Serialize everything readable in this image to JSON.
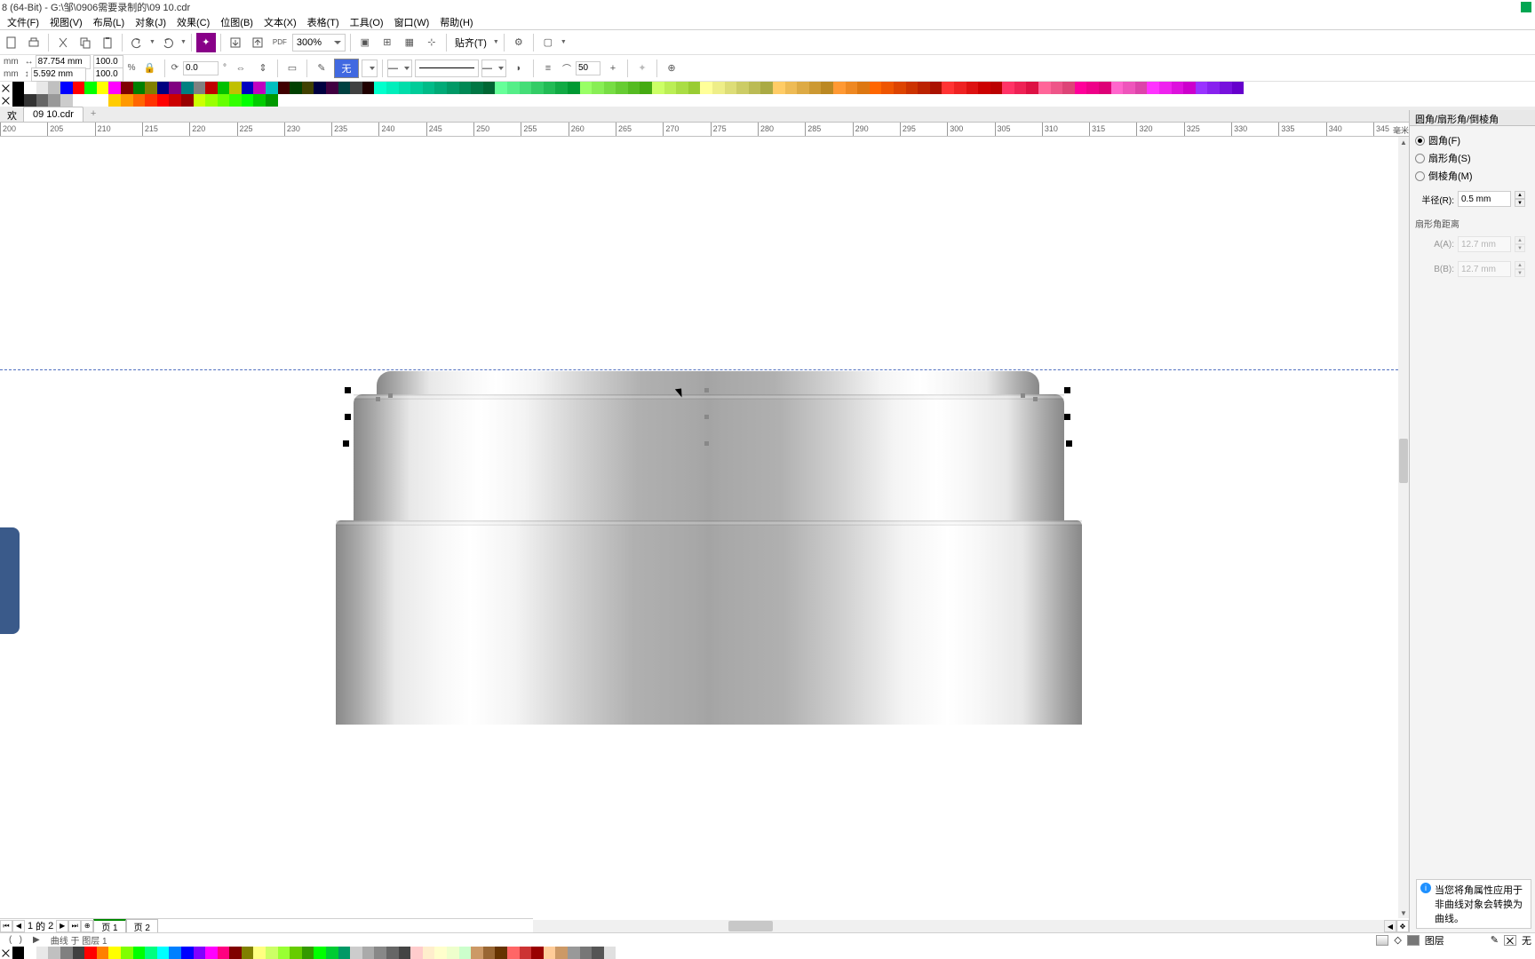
{
  "title": "8 (64-Bit) - G:\\邹\\0906需要录制的\\09 10.cdr",
  "menu": [
    "文件(F)",
    "视图(V)",
    "布局(L)",
    "对象(J)",
    "效果(C)",
    "位图(B)",
    "文本(X)",
    "表格(T)",
    "工具(O)",
    "窗口(W)",
    "帮助(H)"
  ],
  "toolbar1": {
    "zoom": "300%",
    "snap": "贴齐(T)"
  },
  "propbar": {
    "unit1": "mm",
    "unit2": "mm",
    "w": "87.754 mm",
    "h": "5.592 mm",
    "sx": "100.0",
    "sy": "100.0",
    "pct": "%",
    "rot": "0.0",
    "rot_unit": "°",
    "outline_val": "50",
    "none_label": "无"
  },
  "doc_tabs": {
    "first": "欢迎屏幕",
    "active": "09 10.cdr",
    "plus": "+"
  },
  "ruler": {
    "start": 200,
    "end": 345,
    "step": 5,
    "unit": "毫米"
  },
  "panel": {
    "title": "圆角/扇形角/倒棱角",
    "opt1": "圆角(F)",
    "opt2": "扇形角(S)",
    "opt3": "倒棱角(M)",
    "radius_label": "半径(R):",
    "radius_val": "0.5 mm",
    "dist_label": "扇形角距离",
    "a_label": "A(A):",
    "a_val": "12.7 mm",
    "b_label": "B(B):",
    "b_val": "12.7 mm"
  },
  "page_nav": {
    "left2": "⏮",
    "left1": "◀",
    "cur": "1",
    "of": "的",
    "total": "2",
    "right1": "▶",
    "right2": "⏭",
    "add": "⊕",
    "p1": "页 1",
    "p2": "页 2"
  },
  "status": {
    "left1": "▶",
    "object": "曲线 于 图层 1",
    "fill_label": "无",
    "layer": "图层"
  },
  "hint": "当您将角属性应用于非曲线对象会转换为曲线。",
  "colors_top1": [
    "x",
    "#000",
    "#fff",
    "#e8e8e8",
    "#c0c0c0",
    "#0000ff",
    "#ff0000",
    "#00ff00",
    "#ffff00",
    "#ff00ff",
    "#800000",
    "#008000",
    "#808000",
    "#000080",
    "#800080",
    "#008080",
    "#808080",
    "#c00000",
    "#00c000",
    "#c0c000",
    "#0000c0",
    "#c000c0",
    "#00c0c0",
    "#400000",
    "#004000",
    "#404000",
    "#000040",
    "#400040",
    "#004040",
    "#404040",
    "#200000",
    "#00ffcc",
    "#00eebb",
    "#00ddaa",
    "#00cc99",
    "#00bb88",
    "#00aa77",
    "#009966",
    "#008855",
    "#007744",
    "#006633",
    "#66ff99",
    "#55ee88",
    "#44dd77",
    "#33cc66",
    "#22bb55",
    "#11aa44",
    "#009933",
    "#99ff66",
    "#88ee55",
    "#77dd44",
    "#66cc33",
    "#55bb22",
    "#44aa11",
    "#ccff66",
    "#bbee55",
    "#aadd44",
    "#99cc33",
    "#ffff99",
    "#eeee88",
    "#dddd77",
    "#cccc66",
    "#bbbb55",
    "#aaaa44",
    "#ffcc66",
    "#eebb55",
    "#ddaa44",
    "#cc9933",
    "#bb8822",
    "#ff9933",
    "#ee8822",
    "#dd7711",
    "#ff6600",
    "#ee5500",
    "#dd4400",
    "#cc3300",
    "#bb2200",
    "#aa1100",
    "#ff3333",
    "#ee2222",
    "#dd1111",
    "#cc0000",
    "#bb0000",
    "#ff3366",
    "#ee2255",
    "#dd1144",
    "#ff6699",
    "#ee5588",
    "#dd4477",
    "#ff0099",
    "#ee0088",
    "#dd0077",
    "#ff66cc",
    "#ee55bb",
    "#dd44aa",
    "#ff33ff",
    "#ee22ee",
    "#dd11dd",
    "#cc00cc",
    "#9933ff",
    "#8822ee",
    "#7711dd",
    "#6600cc"
  ],
  "colors_top2": [
    "x",
    "#000",
    "#333",
    "#666",
    "#999",
    "#ccc",
    "#fff",
    "#fff",
    "#fff",
    "#ffcc00",
    "#ff9900",
    "#ff6600",
    "#ff3300",
    "#ff0000",
    "#cc0000",
    "#990000",
    "#ccff00",
    "#99ff00",
    "#66ff00",
    "#33ff00",
    "#00ff00",
    "#00cc00",
    "#009900"
  ],
  "colors_bot": [
    "x",
    "#000",
    "#fff",
    "#e8e8e8",
    "#c0c0c0",
    "#808080",
    "#404040",
    "#ff0000",
    "#ff8000",
    "#ffff00",
    "#80ff00",
    "#00ff00",
    "#00ff80",
    "#00ffff",
    "#0080ff",
    "#0000ff",
    "#8000ff",
    "#ff00ff",
    "#ff0080",
    "#800000",
    "#808000",
    "#ffff80",
    "#ccff66",
    "#99ff33",
    "#66cc00",
    "#339900",
    "#00ff00",
    "#00cc33",
    "#009966",
    "#cccccc",
    "#aaaaaa",
    "#888888",
    "#666666",
    "#444444",
    "#ffcccc",
    "#ffeecc",
    "#ffffcc",
    "#eeffcc",
    "#ccffcc",
    "#cc9966",
    "#996633",
    "#663300",
    "#ff6666",
    "#cc3333",
    "#990000",
    "#ffcc99",
    "#cc9966",
    "#999999",
    "#777777",
    "#555555",
    "#e0e0e0"
  ]
}
